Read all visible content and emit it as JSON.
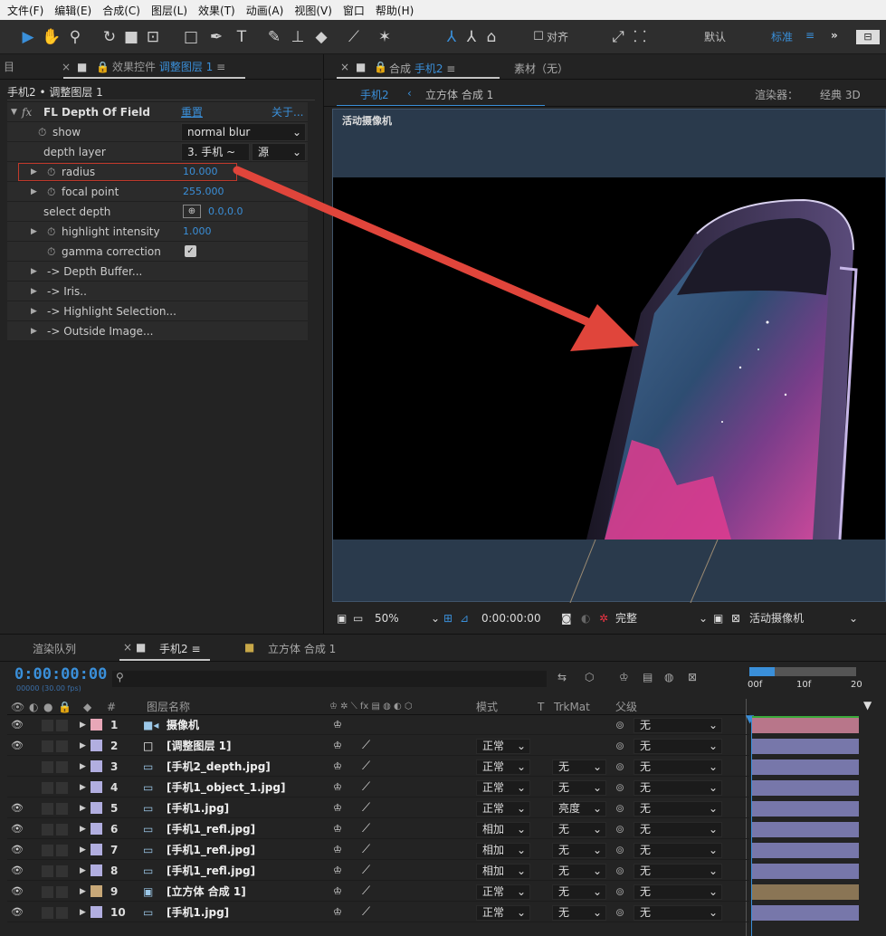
{
  "menu": [
    "文件(F)",
    "编辑(E)",
    "合成(C)",
    "图层(L)",
    "效果(T)",
    "动画(A)",
    "视图(V)",
    "窗口",
    "帮助(H)"
  ],
  "toolbar": {
    "align_label": "对齐",
    "workspace_default": "默认",
    "workspace_standard": "标准",
    "more": "≡",
    "overflow": "»"
  },
  "effect_panel": {
    "left_cut": "目",
    "tab_prefix": "效果控件",
    "tab_layer": "调整图层 1",
    "subtitle": "手机2 • 调整图层 1",
    "effect_name": "FL Depth Of Field",
    "reset": "重置",
    "about": "关于...",
    "rows": [
      {
        "label": "show",
        "value": "normal blur"
      },
      {
        "label": "depth layer",
        "value": "3. 手机 ~",
        "value2": "源"
      },
      {
        "label": "radius",
        "value": "10.000"
      },
      {
        "label": "focal point",
        "value": "255.000"
      },
      {
        "label": "select depth",
        "value": "0.0,0.0"
      },
      {
        "label": "highlight intensity",
        "value": "1.000"
      },
      {
        "label": "gamma correction",
        "value": "checked"
      },
      {
        "label": "-> Depth Buffer..."
      },
      {
        "label": "-> Iris.."
      },
      {
        "label": "-> Highlight Selection..."
      },
      {
        "label": "-> Outside Image..."
      }
    ]
  },
  "comp_panel": {
    "tab_prefix": "合成",
    "tab_comp": "手机2",
    "footage_tab": "素材（无）",
    "crumb_active": "手机2",
    "crumb_next": "立方体 合成 1",
    "renderer": "渲染器：",
    "renderer_value": "经典 3D",
    "viewer_label": "活动摄像机",
    "zoom": "50%",
    "timecode": "0:00:00:00",
    "resolution": "完整",
    "view": "活动摄像机"
  },
  "timeline": {
    "tab_render": "渲染队列",
    "tab_comp": "手机2",
    "tab_cube": "立方体 合成 1",
    "timecode": "0:00:00:00",
    "fps": "00000 (30.00 fps)",
    "col_hash": "#",
    "col_name": "图层名称",
    "col_mode": "模式",
    "col_t": "T",
    "col_trkmat": "TrkMat",
    "col_parent": "父级",
    "ruler_0": "00f",
    "ruler_10": "10f",
    "ruler_20": "20",
    "layers": [
      {
        "num": "1",
        "name": "摄像机",
        "mode": "",
        "trk": "",
        "parent": "无",
        "color": "#e8a7b8",
        "bar": "#b8768a",
        "type": "camera"
      },
      {
        "num": "2",
        "name": "[调整图层 1]",
        "mode": "正常",
        "trk": "",
        "parent": "无",
        "color": "#b1aee0",
        "bar": "#7777aa",
        "type": "adjust"
      },
      {
        "num": "3",
        "name": "[手机2_depth.jpg]",
        "mode": "正常",
        "trk": "无",
        "parent": "无",
        "color": "#b1aee0",
        "bar": "#7777aa",
        "type": "image"
      },
      {
        "num": "4",
        "name": "[手机1_object_1.jpg]",
        "mode": "正常",
        "trk": "无",
        "parent": "无",
        "color": "#b1aee0",
        "bar": "#7777aa",
        "type": "image"
      },
      {
        "num": "5",
        "name": "[手机1.jpg]",
        "mode": "正常",
        "trk": "亮度",
        "parent": "无",
        "color": "#b1aee0",
        "bar": "#7777aa",
        "type": "image"
      },
      {
        "num": "6",
        "name": "[手机1_refl.jpg]",
        "mode": "相加",
        "trk": "无",
        "parent": "无",
        "color": "#b1aee0",
        "bar": "#7777aa",
        "type": "image"
      },
      {
        "num": "7",
        "name": "[手机1_refl.jpg]",
        "mode": "相加",
        "trk": "无",
        "parent": "无",
        "color": "#b1aee0",
        "bar": "#7777aa",
        "type": "image"
      },
      {
        "num": "8",
        "name": "[手机1_refl.jpg]",
        "mode": "相加",
        "trk": "无",
        "parent": "无",
        "color": "#b1aee0",
        "bar": "#7777aa",
        "type": "image"
      },
      {
        "num": "9",
        "name": "[立方体 合成 1]",
        "mode": "正常",
        "trk": "无",
        "parent": "无",
        "color": "#c8a878",
        "bar": "#8a7555",
        "type": "comp"
      },
      {
        "num": "10",
        "name": "[手机1.jpg]",
        "mode": "正常",
        "trk": "无",
        "parent": "无",
        "color": "#b1aee0",
        "bar": "#7777aa",
        "type": "image"
      }
    ]
  },
  "colors": {
    "accent": "#3a8fd9",
    "highlight_box": "#c0392b",
    "arrow": "#e0453b"
  }
}
